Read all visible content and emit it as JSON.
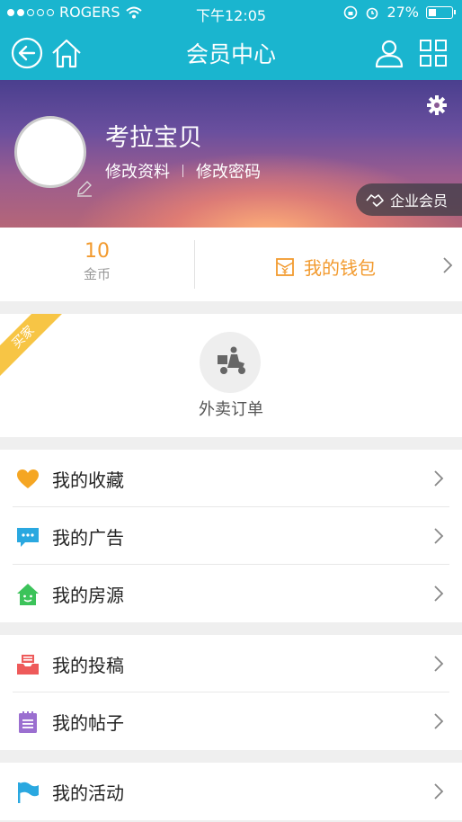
{
  "status_bar": {
    "carrier": "ROGERS",
    "time": "下午12:05",
    "battery": "27%",
    "battery_level": 0.27
  },
  "nav": {
    "title": "会员中心"
  },
  "profile": {
    "username": "考拉宝贝",
    "edit_profile": "修改资料",
    "change_password": "修改密码",
    "membership_badge": "企业会员"
  },
  "stats": {
    "coins_value": "10",
    "coins_label": "金币",
    "wallet_label": "我的钱包"
  },
  "orders": {
    "ribbon": "买家",
    "takeout_label": "外卖订单"
  },
  "menu": {
    "group1": [
      {
        "label": "我的收藏",
        "icon": "heart-icon",
        "color": "#f5a623"
      },
      {
        "label": "我的广告",
        "icon": "chat-bubble-icon",
        "color": "#2aa8e0"
      },
      {
        "label": "我的房源",
        "icon": "house-icon",
        "color": "#3cc35a"
      }
    ],
    "group2": [
      {
        "label": "我的投稿",
        "icon": "inbox-icon",
        "color": "#ee5a5a"
      },
      {
        "label": "我的帖子",
        "icon": "notepad-icon",
        "color": "#9b6fd0"
      }
    ],
    "group3": [
      {
        "label": "我的活动",
        "icon": "flag-icon",
        "color": "#2aa8e0"
      }
    ]
  },
  "colors": {
    "header": "#1ab5cf",
    "accent_orange": "#f29a2e",
    "ribbon_yellow": "#f7c545"
  }
}
